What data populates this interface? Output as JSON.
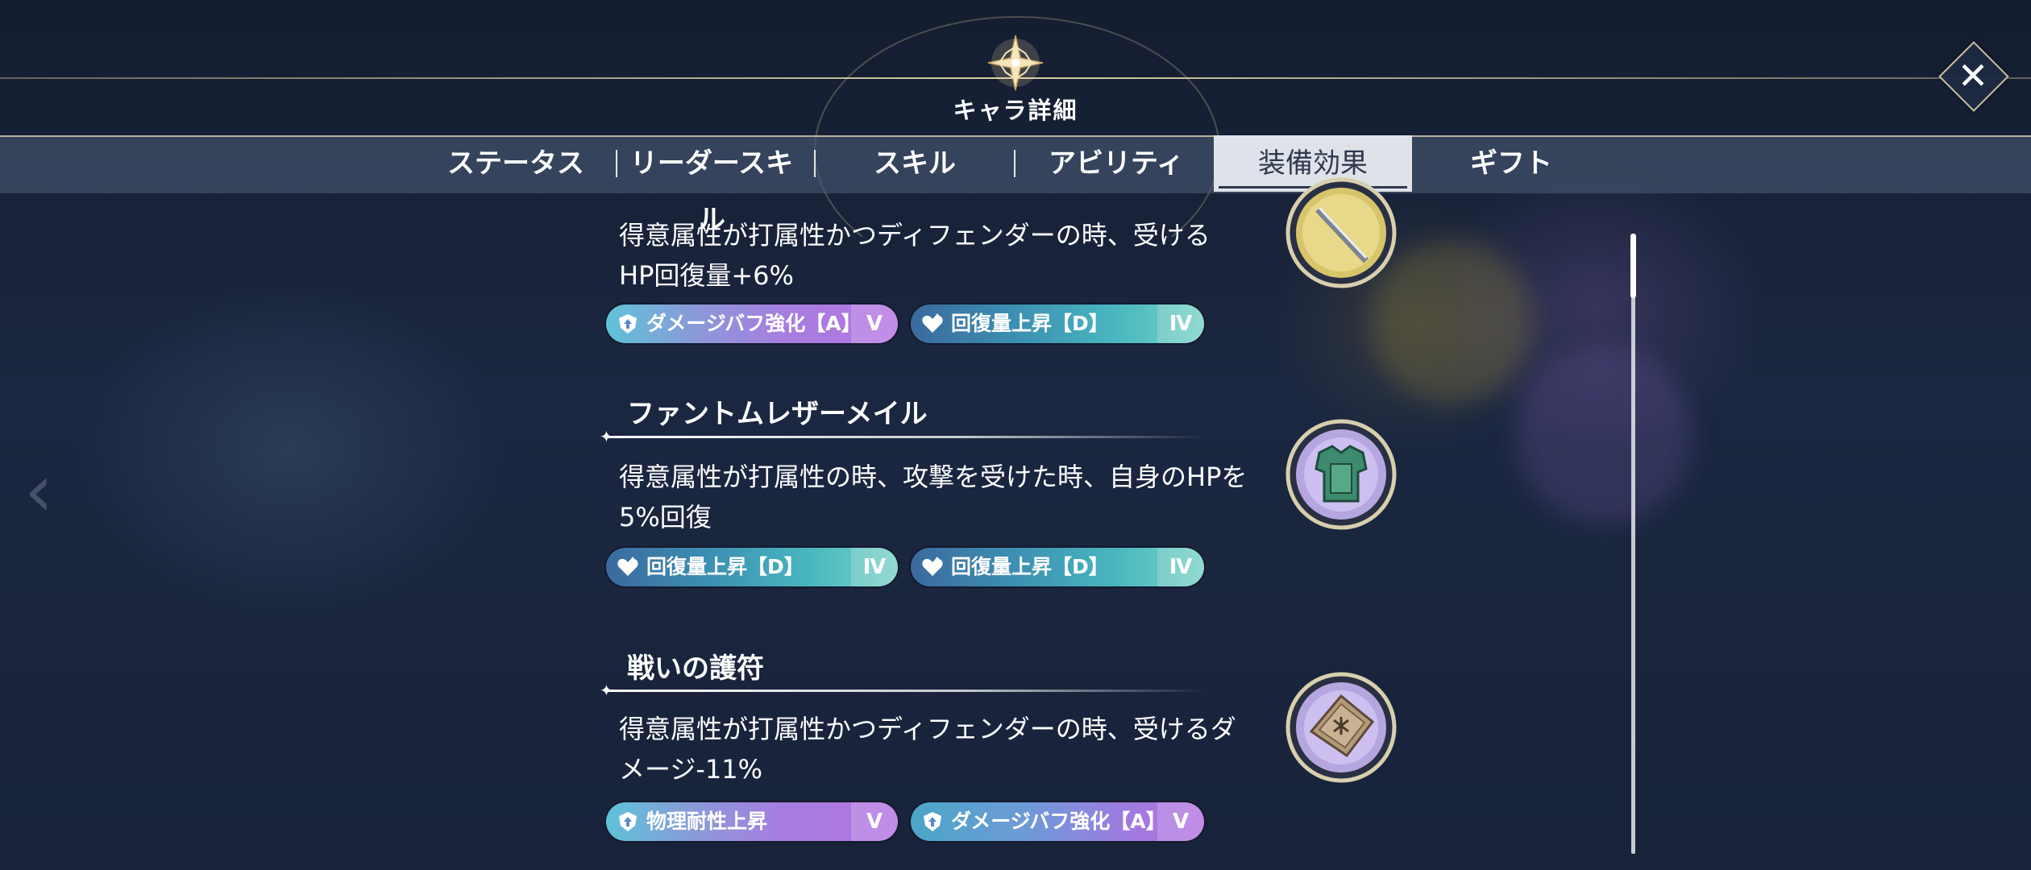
{
  "header": {
    "title": "キャラ詳細",
    "close_label": "✕"
  },
  "tabs": [
    {
      "label": "ステータス"
    },
    {
      "label": "リーダースキル"
    },
    {
      "label": "スキル"
    },
    {
      "label": "アビリティ"
    },
    {
      "label": "装備効果",
      "active": true
    },
    {
      "label": "ギフト"
    }
  ],
  "equipment": [
    {
      "name": "",
      "description_lines": [
        "得意属性が打属性かつディフェンダーの時、受ける",
        "HP回復量+6%"
      ],
      "icon": "staff-disc-icon",
      "tags": [
        {
          "label": "ダメージバフ強化【A】",
          "rank": "Ⅴ",
          "color": "purple",
          "icon": "shield-up-icon"
        },
        {
          "label": "回復量上昇【D】",
          "rank": "Ⅳ",
          "color": "teal",
          "icon": "heart-up-icon"
        }
      ]
    },
    {
      "name": "ファントムレザーメイル",
      "description_lines": [
        "得意属性が打属性の時、攻撃を受けた時、自身のHPを",
        "5%回復"
      ],
      "icon": "leather-armor-icon",
      "tags": [
        {
          "label": "回復量上昇【D】",
          "rank": "Ⅳ",
          "color": "teal",
          "icon": "heart-up-icon"
        },
        {
          "label": "回復量上昇【D】",
          "rank": "Ⅳ",
          "color": "teal",
          "icon": "heart-up-icon"
        }
      ]
    },
    {
      "name": "戦いの護符",
      "description_lines": [
        "得意属性が打属性かつディフェンダーの時、受けるダ",
        "メージ-11%"
      ],
      "icon": "amulet-icon",
      "tags": [
        {
          "label": "物理耐性上昇",
          "rank": "Ⅴ",
          "color": "purple",
          "icon": "shield-up-icon"
        },
        {
          "label": "ダメージバフ強化【A】",
          "rank": "Ⅴ",
          "color": "teal",
          "icon": "shield-up-icon"
        }
      ]
    }
  ],
  "colors": {
    "accent_gold": "#e6d7b0",
    "tag_purple": "#b574e2",
    "tag_teal": "#49b7bf",
    "tab_active_bg": "#dfe2e8"
  }
}
